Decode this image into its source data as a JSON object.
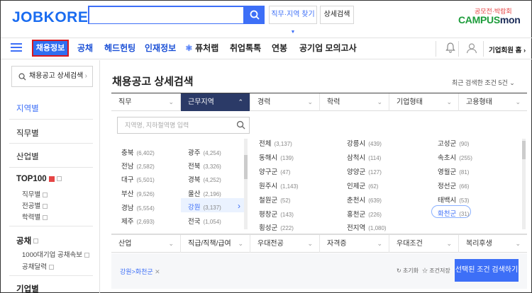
{
  "header": {
    "logo": "JOBKOREA",
    "search": {
      "value": "",
      "placeholder": ""
    },
    "job_region_button": "직무·지역 찾기",
    "detail_search_button": "상세검색",
    "campusmon": {
      "tagline": "공모전·박람회",
      "brand_prefix": "CAMPUS",
      "brand_suffix": "mon"
    }
  },
  "nav": {
    "items": [
      {
        "label": "채용정보",
        "active": true
      },
      {
        "label": "공채"
      },
      {
        "label": "헤드헌팅"
      },
      {
        "label": "인재정보"
      },
      {
        "label": "퓨처랩"
      },
      {
        "label": "취업톡톡"
      },
      {
        "label": "연봉"
      },
      {
        "label": "공기업 모의고사"
      }
    ],
    "member": "기업회원 홈"
  },
  "sidebar": {
    "detail_button": "채용공고 상세검색",
    "items": [
      {
        "label": "지역별",
        "active": true
      },
      {
        "label": "직무별"
      },
      {
        "label": "산업별"
      }
    ],
    "top100": {
      "title": "TOP100",
      "subs": [
        "직무별",
        "전공별",
        "학력별"
      ]
    },
    "gongchae": {
      "title": "공채",
      "subs": [
        "1000대기업 공채속보",
        "공채달력"
      ]
    },
    "company": {
      "title": "기업별"
    }
  },
  "main": {
    "title": "채용공고 상세검색",
    "recent": "최근 검색한 조건 5건",
    "tabs_top": [
      "직무",
      "근무지역",
      "경력",
      "학력",
      "기업형태",
      "고용형태"
    ],
    "active_tab": "근무지역",
    "region_placeholder": "지역명, 지하철역명 입력",
    "provinces_left": [
      {
        "name": "충북",
        "count": "(6,402)"
      },
      {
        "name": "전남",
        "count": "(2,582)"
      },
      {
        "name": "대구",
        "count": "(5,501)"
      },
      {
        "name": "부산",
        "count": "(9,526)"
      },
      {
        "name": "경남",
        "count": "(5,554)"
      },
      {
        "name": "제주",
        "count": "(2,693)"
      }
    ],
    "provinces_right": [
      {
        "name": "광주",
        "count": "(4,254)"
      },
      {
        "name": "전북",
        "count": "(3,326)"
      },
      {
        "name": "경북",
        "count": "(4,252)"
      },
      {
        "name": "울산",
        "count": "(2,196)"
      },
      {
        "name": "강원",
        "count": "(3,137)",
        "selected": true
      },
      {
        "name": "전국",
        "count": "(1,054)"
      }
    ],
    "cities_col1": [
      {
        "name": "전체",
        "count": "(3,137)"
      },
      {
        "name": "동해시",
        "count": "(139)"
      },
      {
        "name": "양구군",
        "count": "(47)"
      },
      {
        "name": "원주시",
        "count": "(1,143)"
      },
      {
        "name": "철원군",
        "count": "(52)"
      },
      {
        "name": "평창군",
        "count": "(143)"
      },
      {
        "name": "횡성군",
        "count": "(222)"
      }
    ],
    "cities_col2": [
      {
        "name": "강릉시",
        "count": "(439)"
      },
      {
        "name": "삼척시",
        "count": "(114)"
      },
      {
        "name": "양양군",
        "count": "(127)"
      },
      {
        "name": "인제군",
        "count": "(62)"
      },
      {
        "name": "춘천시",
        "count": "(639)"
      },
      {
        "name": "홍천군",
        "count": "(226)"
      },
      {
        "name": "전지역",
        "count": "(1,080)"
      }
    ],
    "cities_col3": [
      {
        "name": "고성군",
        "count": "(90)"
      },
      {
        "name": "속초시",
        "count": "(255)"
      },
      {
        "name": "영월군",
        "count": "(81)"
      },
      {
        "name": "정선군",
        "count": "(66)"
      },
      {
        "name": "태백시",
        "count": "(53)"
      },
      {
        "name": "화천군",
        "count": "(31)",
        "selected": true
      }
    ],
    "tabs_bottom": [
      "산업",
      "직급/직책/급여",
      "우대전공",
      "자격증",
      "우대조건",
      "복리후생"
    ],
    "selected_tag": "강원>화천군",
    "reset": "초기화",
    "save": "조건저장",
    "apply": "선택된 조건 검색하기"
  },
  "colors": {
    "brand": "#3d6ff7",
    "nav_dark": "#2b3a67",
    "highlight_border": "#d9181d"
  }
}
